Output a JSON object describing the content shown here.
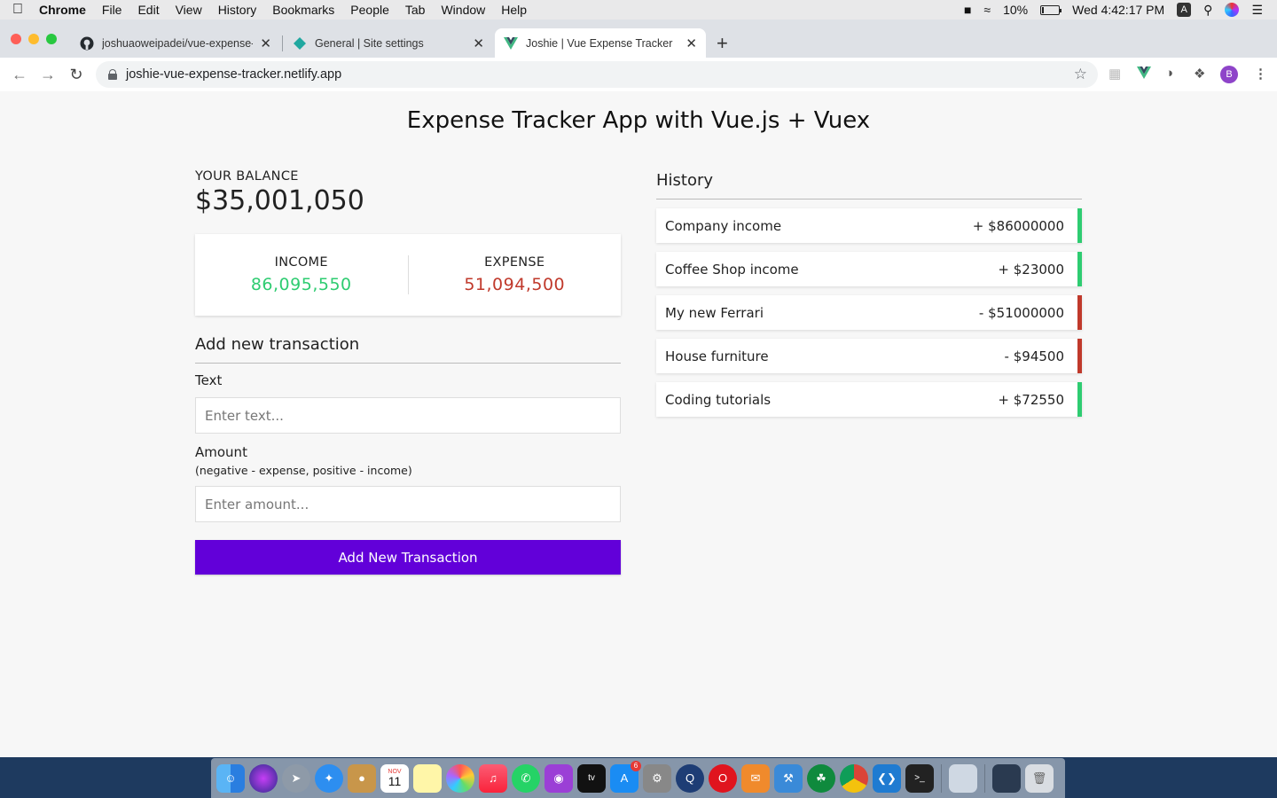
{
  "menubar": {
    "app_name": "Chrome",
    "items": [
      "File",
      "Edit",
      "View",
      "History",
      "Bookmarks",
      "People",
      "Tab",
      "Window",
      "Help"
    ],
    "battery": "10%",
    "clock": "Wed 4:42:17 PM"
  },
  "browser": {
    "tabs": [
      {
        "title": "joshuaoweipadei/vue-expense-tracker",
        "icon": "github-icon"
      },
      {
        "title": "General | Site settings",
        "icon": "netlify-icon"
      },
      {
        "title": "Joshie | Vue Expense Tracker",
        "icon": "vue-icon"
      }
    ],
    "url": "joshie-vue-expense-tracker.netlify.app",
    "profile_initial": "B"
  },
  "app": {
    "title": "Expense Tracker App with Vue.js + Vuex",
    "balance_label": "YOUR BALANCE",
    "balance_value": "$35,001,050",
    "income_label": "INCOME",
    "income_value": "86,095,550",
    "expense_label": "EXPENSE",
    "expense_value": "51,094,500",
    "add_heading": "Add new transaction",
    "text_label": "Text",
    "text_placeholder": "Enter text...",
    "amount_label": "Amount",
    "amount_hint": "(negative - expense, positive - income)",
    "amount_placeholder": "Enter amount...",
    "submit_label": "Add New Transaction",
    "history_heading": "History",
    "history": [
      {
        "text": "Company income",
        "amount": "+ $86000000",
        "type": "income"
      },
      {
        "text": "Coffee Shop income",
        "amount": "+ $23000",
        "type": "income"
      },
      {
        "text": "My new Ferrari",
        "amount": "- $51000000",
        "type": "expense"
      },
      {
        "text": "House furniture",
        "amount": "- $94500",
        "type": "expense"
      },
      {
        "text": "Coding tutorials",
        "amount": "+ $72550",
        "type": "income"
      }
    ],
    "colors": {
      "income": "#2ecc71",
      "expense": "#c0392b",
      "button": "#6200d9"
    }
  },
  "dock": {
    "apps": [
      "finder-icon",
      "siri-icon",
      "launchpad-icon",
      "safari-icon",
      "contacts-icon",
      "calendar-icon",
      "notes-icon",
      "photos-icon",
      "music-icon",
      "whatsapp-icon",
      "podcasts-icon",
      "appletv-icon",
      "appstore-icon",
      "system-preferences-icon",
      "quicktime-icon",
      "opera-icon",
      "cardhop-icon",
      "xcode-icon",
      "mongodb-icon",
      "chrome-icon",
      "vscode-icon",
      "terminal-icon",
      "preview-icon",
      "screen-icon",
      "trash-icon"
    ],
    "calendar_month": "NOV",
    "calendar_day": "11",
    "appstore_badge": "6"
  }
}
